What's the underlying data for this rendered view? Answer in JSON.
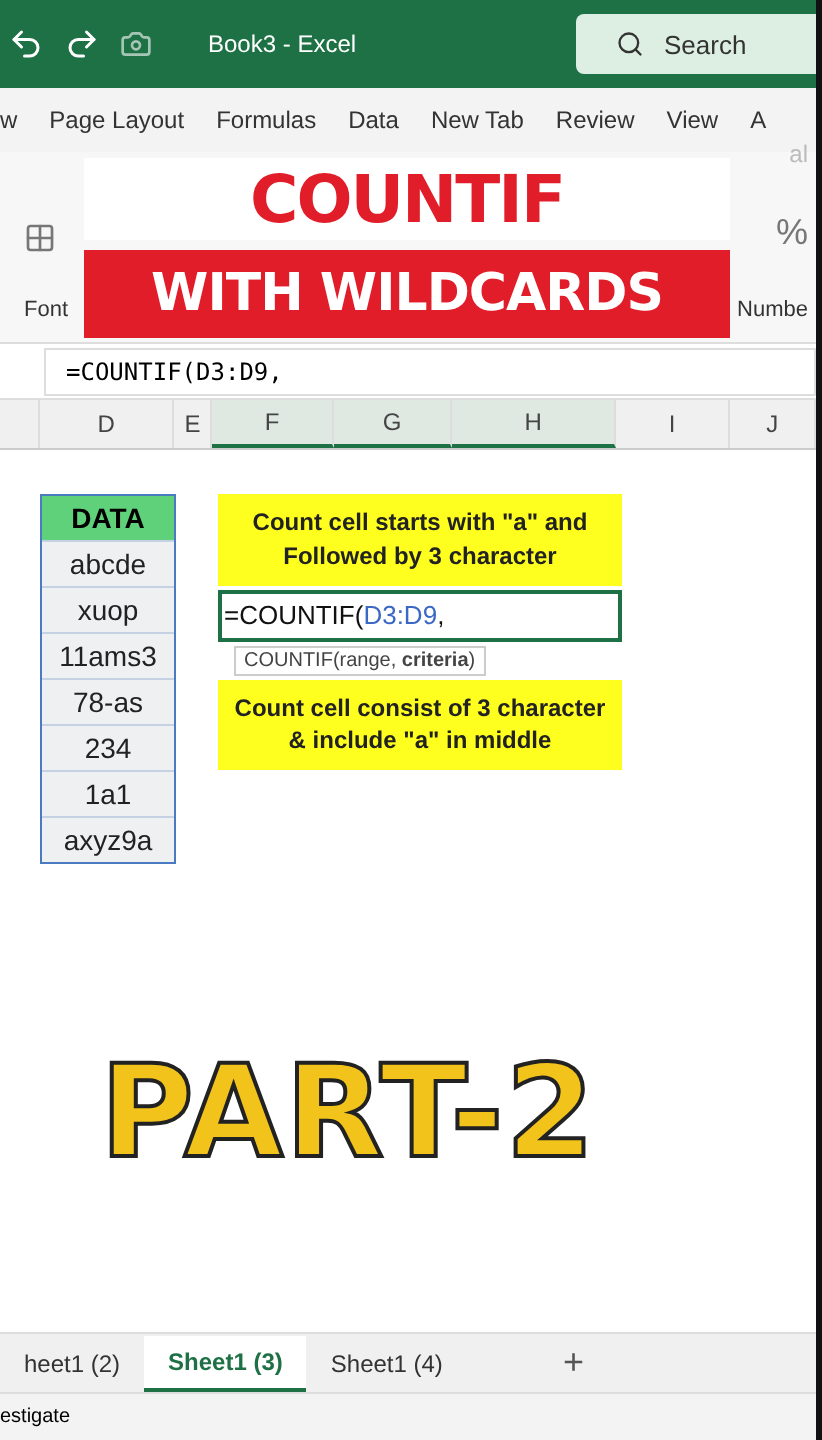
{
  "title_bar": {
    "title": "Book3 - Excel",
    "search": {
      "placeholder": "Search"
    }
  },
  "ribbon_tabs": [
    {
      "label": "w",
      "selected": false
    },
    {
      "label": "Page Layout",
      "selected": false
    },
    {
      "label": "Formulas",
      "selected": false
    },
    {
      "label": "Data",
      "selected": false
    },
    {
      "label": "New Tab",
      "selected": false
    },
    {
      "label": "Review",
      "selected": false
    },
    {
      "label": "View",
      "selected": false
    },
    {
      "label": "A",
      "selected": false
    }
  ],
  "ribbon": {
    "field_text": "al",
    "percent": "%",
    "groups": [
      "Font",
      "Numbe"
    ]
  },
  "overlay": {
    "title": "COUNTIF",
    "subtitle": "WITH WILDCARDS",
    "footer": "PART-2"
  },
  "formula_bar": {
    "value": "=COUNTIF(D3:D9,"
  },
  "columns": [
    {
      "label": "D",
      "selected": false
    },
    {
      "label": "E",
      "selected": false
    },
    {
      "label": "F",
      "selected": true
    },
    {
      "label": "G",
      "selected": true
    },
    {
      "label": "H",
      "selected": true
    },
    {
      "label": "I",
      "selected": false
    },
    {
      "label": "J",
      "selected": false
    }
  ],
  "data_table": {
    "header": "DATA",
    "rows": [
      "abcde",
      "xuop",
      "11ams3",
      "78-as",
      "234",
      "1a1",
      "axyz9a"
    ]
  },
  "notes": [
    {
      "text": "Count cell starts with \"a\" and Followed by 3 character"
    },
    {
      "text": "Count cell consist of 3 character & include  \"a\" in middle"
    }
  ],
  "edit_cell": {
    "prefix": "=COUNTIF(",
    "reference": "D3:D9",
    "suffix": ","
  },
  "tooltip": {
    "function": "COUNTIF(range, ",
    "argument": "criteria",
    "end": ")"
  },
  "sheet_tabs": [
    {
      "label": "heet1 (2)",
      "selected": false
    },
    {
      "label": "Sheet1 (3)",
      "selected": true
    },
    {
      "label": "Sheet1 (4)",
      "selected": false
    }
  ],
  "add_sheet": "+",
  "status_bar": {
    "text": "estigate"
  }
}
